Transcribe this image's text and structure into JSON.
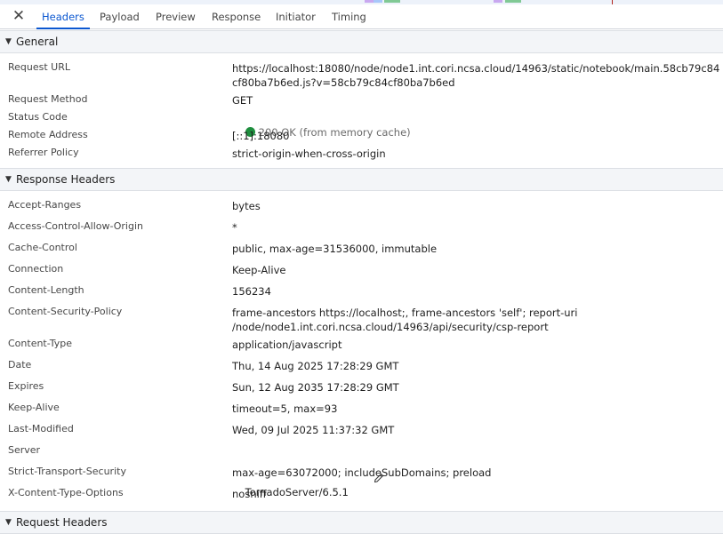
{
  "tabs": [
    {
      "label": "Headers"
    },
    {
      "label": "Payload"
    },
    {
      "label": "Preview"
    },
    {
      "label": "Response"
    },
    {
      "label": "Initiator"
    },
    {
      "label": "Timing"
    }
  ],
  "general": {
    "title": "General",
    "rows": [
      {
        "name": "Request URL",
        "value": "https://localhost:18080/node/node1.int.cori.ncsa.cloud/14963/static/notebook/main.58cb79c84cf80ba7b6ed.js?v=58cb79c84cf80ba7b6ed"
      },
      {
        "name": "Request Method",
        "value": "GET"
      },
      {
        "name": "Status Code",
        "value": "200 OK (from memory cache)"
      },
      {
        "name": "Remote Address",
        "value": "[::1]:18080"
      },
      {
        "name": "Referrer Policy",
        "value": "strict-origin-when-cross-origin"
      }
    ]
  },
  "response_headers": {
    "title": "Response Headers",
    "rows": [
      {
        "name": "Accept-Ranges",
        "value": "bytes"
      },
      {
        "name": "Access-Control-Allow-Origin",
        "value": "*"
      },
      {
        "name": "Cache-Control",
        "value": "public, max-age=31536000, immutable"
      },
      {
        "name": "Connection",
        "value": "Keep-Alive"
      },
      {
        "name": "Content-Length",
        "value": "156234"
      },
      {
        "name": "Content-Security-Policy",
        "value": "frame-ancestors https://localhost;, frame-ancestors 'self'; report-uri\n/node/node1.int.cori.ncsa.cloud/14963/api/security/csp-report"
      },
      {
        "name": "Content-Type",
        "value": "application/javascript"
      },
      {
        "name": "Date",
        "value": "Thu, 14 Aug 2025 17:28:29 GMT"
      },
      {
        "name": "Expires",
        "value": "Sun, 12 Aug 2035 17:28:29 GMT"
      },
      {
        "name": "Keep-Alive",
        "value": "timeout=5, max=93"
      },
      {
        "name": "Last-Modified",
        "value": "Wed, 09 Jul 2025 11:37:32 GMT"
      },
      {
        "name": "Server",
        "value": "TornadoServer/6.5.1"
      },
      {
        "name": "Strict-Transport-Security",
        "value": "max-age=63072000; includeSubDomains; preload"
      },
      {
        "name": "X-Content-Type-Options",
        "value": "nosniff"
      }
    ]
  },
  "request_headers": {
    "title": "Request Headers"
  },
  "colors": {
    "accent": "#0b57d0",
    "status_ok": "#1e8e3e",
    "section_bg": "#f3f5f8"
  },
  "icons": {
    "close": "close-icon",
    "collapse": "triangle-down-icon",
    "status": "status-ok-dot-icon",
    "edit": "pencil-icon"
  }
}
